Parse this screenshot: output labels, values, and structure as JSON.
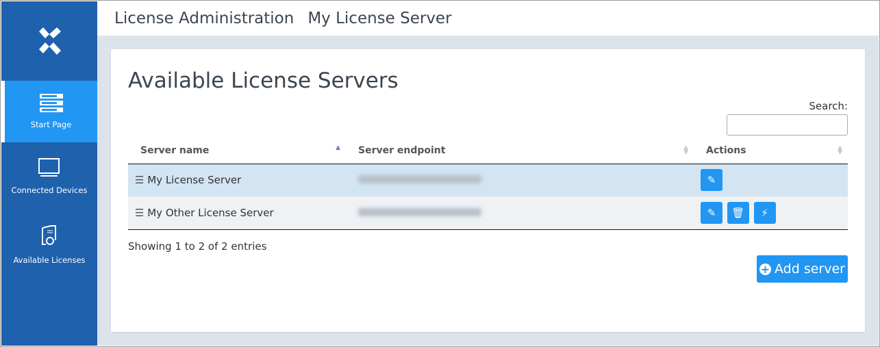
{
  "header": {
    "app": "License Administration",
    "page": "My License Server"
  },
  "sidebar": {
    "items": [
      {
        "label": "Start Page",
        "icon": "server-icon",
        "active": true
      },
      {
        "label": "Connected Devices",
        "icon": "monitor-icon"
      },
      {
        "label": "Available Licenses",
        "icon": "certificate-icon"
      }
    ]
  },
  "main": {
    "title": "Available License Servers",
    "search_label": "Search:",
    "search_value": "",
    "columns": [
      "Server name",
      "Server endpoint",
      "Actions"
    ],
    "rows": [
      {
        "name": "My License Server",
        "actions": [
          "edit"
        ]
      },
      {
        "name": "My Other License Server",
        "actions": [
          "edit",
          "delete",
          "connect"
        ]
      }
    ],
    "info": "Showing 1 to 2 of 2 entries",
    "add_label": "Add server"
  },
  "colors": {
    "sidebar": "#1e61ad",
    "active": "#2196f3",
    "row_selected": "#d3e4f3"
  }
}
